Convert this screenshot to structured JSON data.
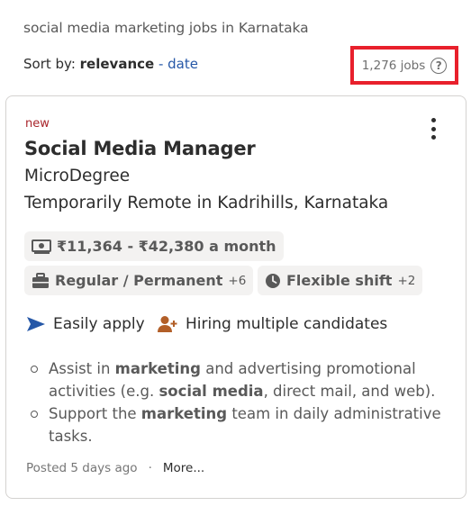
{
  "header": {
    "query": "social media marketing jobs in Karnataka",
    "sort_prefix": "Sort by: ",
    "sort_active": "relevance",
    "sort_separator": " - ",
    "sort_alt": "date",
    "jobs_count": "1,276 jobs"
  },
  "job": {
    "tag": "new",
    "title": "Social Media Manager",
    "company": "MicroDegree",
    "location": "Temporarily Remote in Kadrihills, Karnataka",
    "salary": "₹11,364 - ₹42,380 a month",
    "job_type": "Regular / Permanent",
    "job_type_extra": "+6",
    "shift": "Flexible shift",
    "shift_extra": "+2",
    "easily_apply": "Easily apply",
    "hiring": "Hiring multiple candidates",
    "bullets": [
      {
        "t1": "Assist in ",
        "b1": "marketing",
        "t2": " and advertising promotional activities (e.g. ",
        "b2": "social media",
        "t3": ", direct mail, and web)."
      },
      {
        "t1": "Support the ",
        "b1": "marketing",
        "t2": " team in daily administrative tasks."
      }
    ],
    "posted": "Posted 5 days ago",
    "dot": "·",
    "more": "More..."
  },
  "colors": {
    "accent": "#2557a7",
    "new_tag": "#a9252b",
    "highlight_box": "#e8202c",
    "hiring_icon": "#b25f28"
  },
  "icons": [
    "help-icon",
    "kebab-menu-icon",
    "money-icon",
    "briefcase-icon",
    "clock-icon",
    "send-icon",
    "person-add-icon"
  ]
}
